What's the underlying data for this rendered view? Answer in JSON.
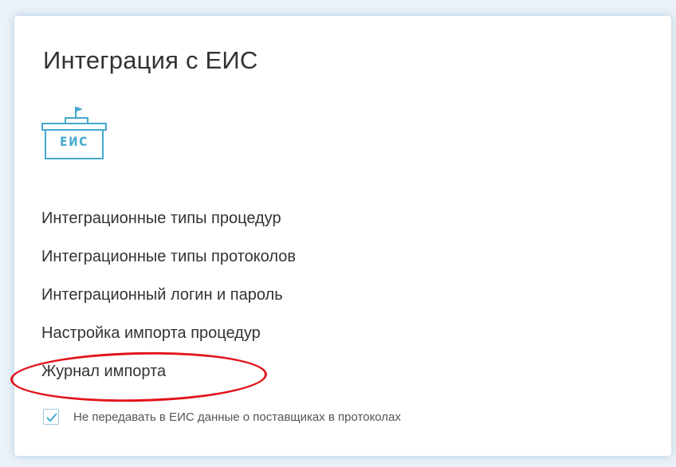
{
  "card": {
    "title": "Интеграция с ЕИС",
    "logo_text": "ЕИС",
    "logo_icon": "eis-building-flag-icon"
  },
  "links": [
    "Интеграционные типы процедур",
    "Интеграционные типы протоколов",
    "Интеграционный логин и пароль",
    "Настройка импорта процедур",
    "Журнал импорта"
  ],
  "checkbox": {
    "checked": true,
    "label": "Не передавать в ЕИС данные о поставщиках в протоколах"
  },
  "colors": {
    "accent": "#45a8cf",
    "highlight": "#e1141c",
    "text": "#333333"
  }
}
